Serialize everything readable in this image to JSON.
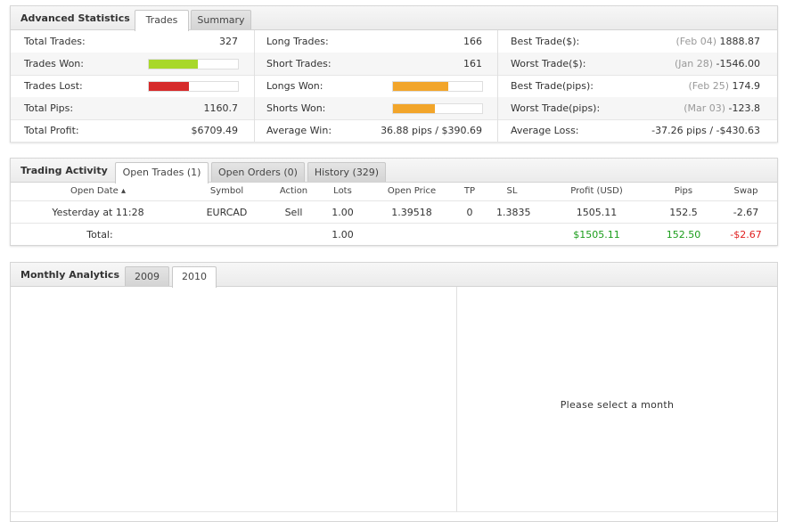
{
  "advanced": {
    "title": "Advanced Statistics",
    "tabs": [
      "Trades",
      "Summary"
    ],
    "col1": {
      "total_trades_label": "Total Trades:",
      "total_trades": "327",
      "trades_won_label": "Trades Won:",
      "trades_won_fill": 0.55,
      "trades_lost_label": "Trades Lost:",
      "trades_lost_fill": 0.45,
      "total_pips_label": "Total Pips:",
      "total_pips": "1160.7",
      "total_profit_label": "Total Profit:",
      "total_profit": "$6709.49"
    },
    "col2": {
      "long_trades_label": "Long Trades:",
      "long_trades": "166",
      "short_trades_label": "Short Trades:",
      "short_trades": "161",
      "longs_won_label": "Longs Won:",
      "longs_won_fill": 0.62,
      "shorts_won_label": "Shorts Won:",
      "shorts_won_fill": 0.47,
      "average_win_label": "Average Win:",
      "average_win": "36.88 pips / $390.69"
    },
    "col3": {
      "best_trade_usd_label": "Best Trade($):",
      "best_trade_usd_date": "(Feb 04)",
      "best_trade_usd": "1888.87",
      "worst_trade_usd_label": "Worst Trade($):",
      "worst_trade_usd_date": "(Jan 28)",
      "worst_trade_usd": "-1546.00",
      "best_trade_pips_label": "Best Trade(pips):",
      "best_trade_pips_date": "(Feb 25)",
      "best_trade_pips": "174.9",
      "worst_trade_pips_label": "Worst Trade(pips):",
      "worst_trade_pips_date": "(Mar 03)",
      "worst_trade_pips": "-123.8",
      "average_loss_label": "Average Loss:",
      "average_loss": "-37.26 pips / -$430.63"
    },
    "colors": {
      "won": "#a8d82a",
      "lost": "#d62a2a",
      "long_short": "#f2a52a"
    }
  },
  "activity": {
    "title": "Trading Activity",
    "tabs": [
      "Open Trades (1)",
      "Open Orders (0)",
      "History (329)"
    ],
    "columns": [
      "Open Date ▴",
      "Symbol",
      "Action",
      "Lots",
      "Open Price",
      "TP",
      "SL",
      "Profit (USD)",
      "Pips",
      "Swap"
    ],
    "row": [
      "Yesterday at 11:28",
      "EURCAD",
      "Sell",
      "1.00",
      "1.39518",
      "0",
      "1.3835",
      "1505.11",
      "152.5",
      "-2.67"
    ],
    "total": {
      "label": "Total:",
      "lots": "1.00",
      "profit": "$1505.11",
      "pips": "152.50",
      "swap": "-$2.67"
    }
  },
  "monthly": {
    "title": "Monthly Analytics",
    "tabs": [
      "2009",
      "2010"
    ],
    "placeholder": "Please select a month"
  }
}
